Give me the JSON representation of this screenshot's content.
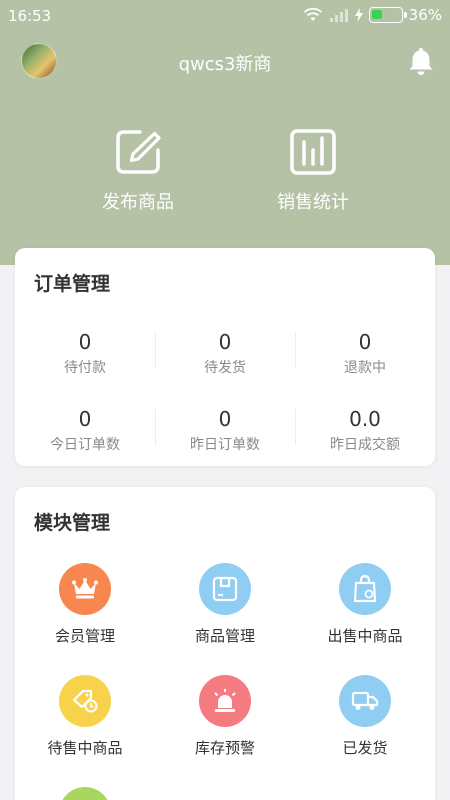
{
  "status_bar": {
    "time": "16:53",
    "battery": "36%",
    "battery_level": 0.36
  },
  "header": {
    "shop_name": "qwcs3新商"
  },
  "quick_actions": [
    {
      "label": "发布商品",
      "icon": "edit-icon"
    },
    {
      "label": "销售统计",
      "icon": "bar-chart-icon"
    }
  ],
  "orders": {
    "title": "订单管理",
    "stats": [
      {
        "value": "0",
        "label": "待付款"
      },
      {
        "value": "0",
        "label": "待发货"
      },
      {
        "value": "0",
        "label": "退款中"
      },
      {
        "value": "0",
        "label": "今日订单数"
      },
      {
        "value": "0",
        "label": "昨日订单数"
      },
      {
        "value": "0.0",
        "label": "昨日成交额"
      }
    ]
  },
  "modules": {
    "title": "模块管理",
    "items": [
      {
        "label": "会员管理",
        "icon": "crown-icon",
        "color": "#f7874f"
      },
      {
        "label": "商品管理",
        "icon": "box-icon",
        "color": "#8fcdf3"
      },
      {
        "label": "出售中商品",
        "icon": "shopping-bag-icon",
        "color": "#8fcdf3"
      },
      {
        "label": "待售中商品",
        "icon": "price-tag-clock-icon",
        "color": "#f9d24c"
      },
      {
        "label": "库存预警",
        "icon": "alarm-light-icon",
        "color": "#f47b80"
      },
      {
        "label": "已发货",
        "icon": "delivery-truck-icon",
        "color": "#8fcdf3"
      }
    ],
    "partial_icon_color": "#a8d760"
  },
  "colors": {
    "header_bg": "#b5c2a6",
    "page_bg": "#f2f2f4",
    "card_bg": "#ffffff"
  }
}
